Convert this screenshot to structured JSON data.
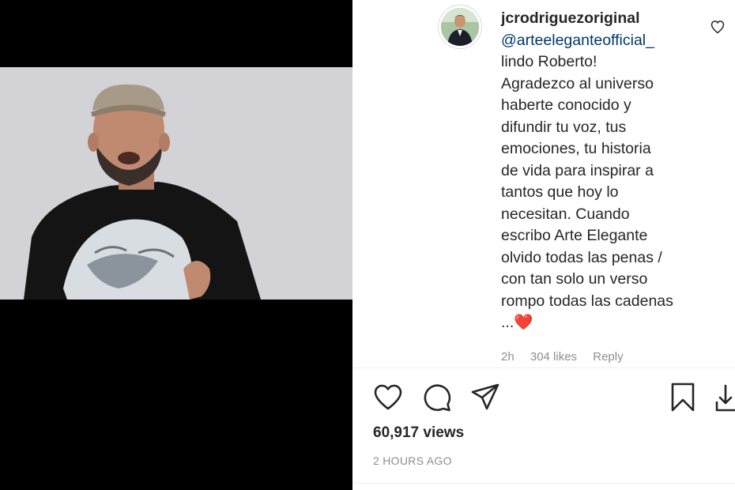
{
  "post": {
    "comment": {
      "username": "jcrodriguezoriginal",
      "mention": "@arteeleganteofficial_",
      "lines": [
        "lindo Roberto!",
        "Agradezco al universo",
        "haberte conocido y",
        "difundir tu voz, tus",
        "emociones, tu historia",
        "de vida para inspirar a",
        "tantos que hoy lo",
        "necesitan. Cuando",
        "escribo Arte Elegante",
        "olvido todas las penas /",
        "con tan solo un verso",
        "rompo todas las cadenas",
        "..."
      ],
      "emoji": "❤️",
      "age": "2h",
      "likes": "304 likes",
      "reply_label": "Reply"
    },
    "views": "60,917 views",
    "posted_time": "2 HOURS AGO",
    "colors": {
      "text": "#262626",
      "muted": "#8e8e8e",
      "mention": "#00376b",
      "heart": "#e0212c"
    }
  }
}
